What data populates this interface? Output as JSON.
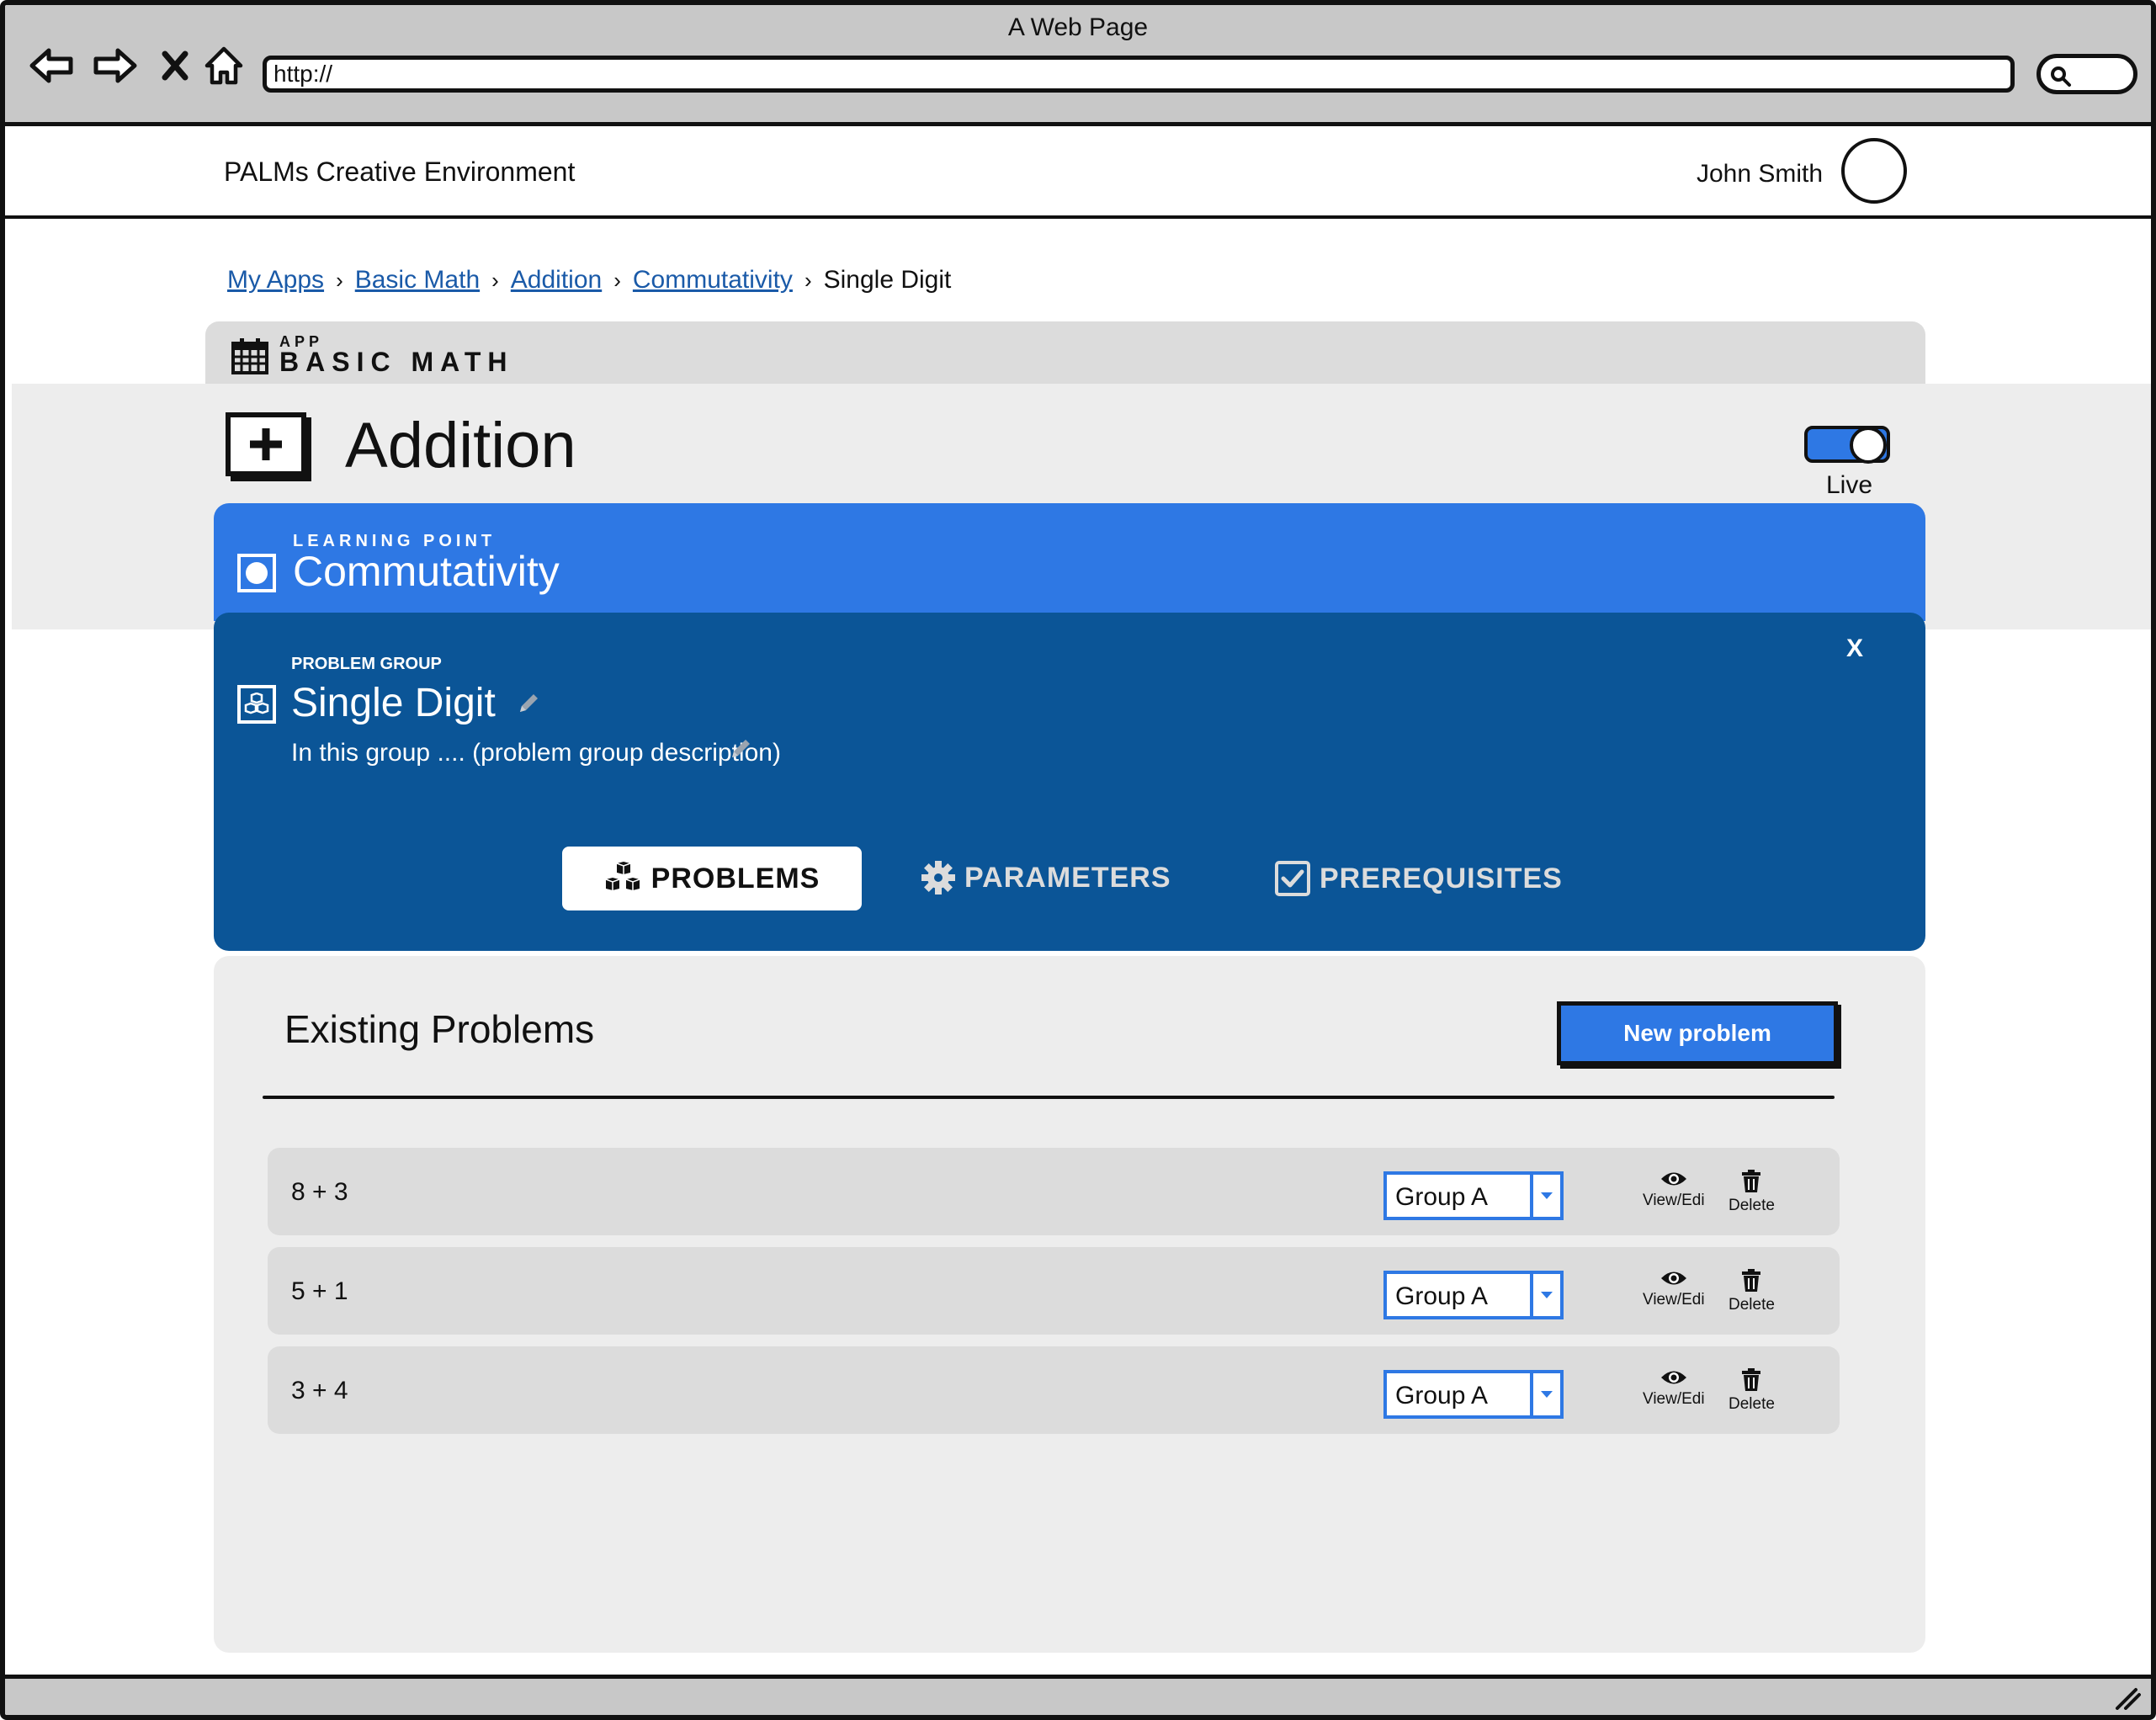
{
  "browser": {
    "window_title": "A Web Page",
    "url": "http://",
    "icons": [
      "back-arrow-icon",
      "forward-arrow-icon",
      "close-x-icon",
      "home-icon",
      "search-icon",
      "resize-grip-icon"
    ]
  },
  "header": {
    "brand": "PALMs Creative Environment",
    "user_name": "John Smith"
  },
  "breadcrumb": {
    "items": [
      "My Apps",
      "Basic Math",
      "Addition",
      "Commutativity"
    ],
    "current": "Single Digit",
    "separator": "›"
  },
  "app": {
    "kicker": "APP",
    "name": "BASIC MATH",
    "icon": "calendar-icon"
  },
  "topic": {
    "title": "Addition",
    "icon": "plus-box-icon",
    "toggle_label": "Live",
    "toggle_on": true
  },
  "learning_point": {
    "kicker": "LEARNING POINT",
    "title": "Commutativity"
  },
  "problem_group": {
    "kicker": "PROBLEM GROUP",
    "title": "Single Digit",
    "description": "In this group .... (problem group description)",
    "close_label": "X"
  },
  "tabs": [
    {
      "label": "PROBLEMS",
      "icon": "cubes-icon",
      "active": true
    },
    {
      "label": "PARAMETERS",
      "icon": "gear-icon",
      "active": false
    },
    {
      "label": "PREREQUISITES",
      "icon": "checkbox-icon",
      "active": false
    }
  ],
  "existing": {
    "title": "Existing Problems",
    "new_button": "New problem",
    "view_label": "View/Edi",
    "delete_label": "Delete",
    "rows": [
      {
        "expression": "8 + 3",
        "group": "Group A"
      },
      {
        "expression": "5 + 1",
        "group": "Group A"
      },
      {
        "expression": "3 + 4",
        "group": "Group A"
      }
    ]
  },
  "colors": {
    "accent_blue": "#2e78e4",
    "dark_blue": "#0b5597",
    "panel_gray": "#ededed",
    "row_gray": "#dcdcdc"
  }
}
